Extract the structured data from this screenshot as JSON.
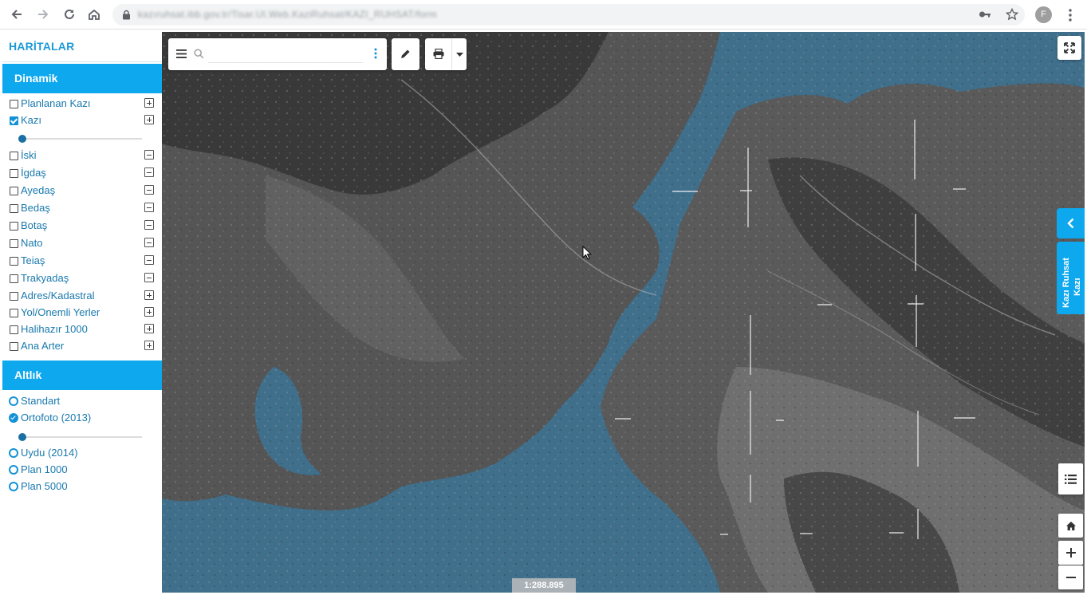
{
  "browser": {
    "url": "kazıruhsat.ibb.gov.tr/Tisar.UI.Web.KaziRuhsat/KAZI_RUHSAT/form",
    "profile_initial": "F"
  },
  "sidebar": {
    "title": "HARİTALAR",
    "dinamik": {
      "header": "Dinamik",
      "layers": [
        {
          "label": "Planlanan Kazı",
          "checked": false,
          "toggle": "plus"
        },
        {
          "label": "Kazı",
          "checked": true,
          "toggle": "plus",
          "opacity": 0
        },
        {
          "label": "İski",
          "checked": false,
          "toggle": "minus"
        },
        {
          "label": "İgdaş",
          "checked": false,
          "toggle": "minus"
        },
        {
          "label": "Ayedaş",
          "checked": false,
          "toggle": "minus"
        },
        {
          "label": "Bedaş",
          "checked": false,
          "toggle": "minus"
        },
        {
          "label": "Botaş",
          "checked": false,
          "toggle": "minus"
        },
        {
          "label": "Nato",
          "checked": false,
          "toggle": "minus"
        },
        {
          "label": "Teiaş",
          "checked": false,
          "toggle": "minus"
        },
        {
          "label": "Trakyadaş",
          "checked": false,
          "toggle": "minus"
        },
        {
          "label": "Adres/Kadastral",
          "checked": false,
          "toggle": "plus"
        },
        {
          "label": "Yol/Onemli Yerler",
          "checked": false,
          "toggle": "plus"
        },
        {
          "label": "Halihazır 1000",
          "checked": false,
          "toggle": "plus"
        },
        {
          "label": "Ana Arter",
          "checked": false,
          "toggle": "plus"
        }
      ]
    },
    "altlik": {
      "header": "Altlık",
      "layers": [
        {
          "label": "Standart",
          "selected": false
        },
        {
          "label": "Ortofoto (2013)",
          "selected": true,
          "opacity": 0
        },
        {
          "label": "Uydu (2014)",
          "selected": false
        },
        {
          "label": "Plan 1000",
          "selected": false
        },
        {
          "label": "Plan 5000",
          "selected": false
        }
      ]
    }
  },
  "map": {
    "search": {
      "value": "",
      "placeholder": ""
    },
    "side_tab": {
      "line1": "Kazı Ruhsat",
      "line2": "Kazı"
    },
    "scale": "1:288.895",
    "colors": {
      "accent": "#0ea8ee",
      "link": "#1a79ad",
      "sea": "#3d6f8c"
    }
  }
}
